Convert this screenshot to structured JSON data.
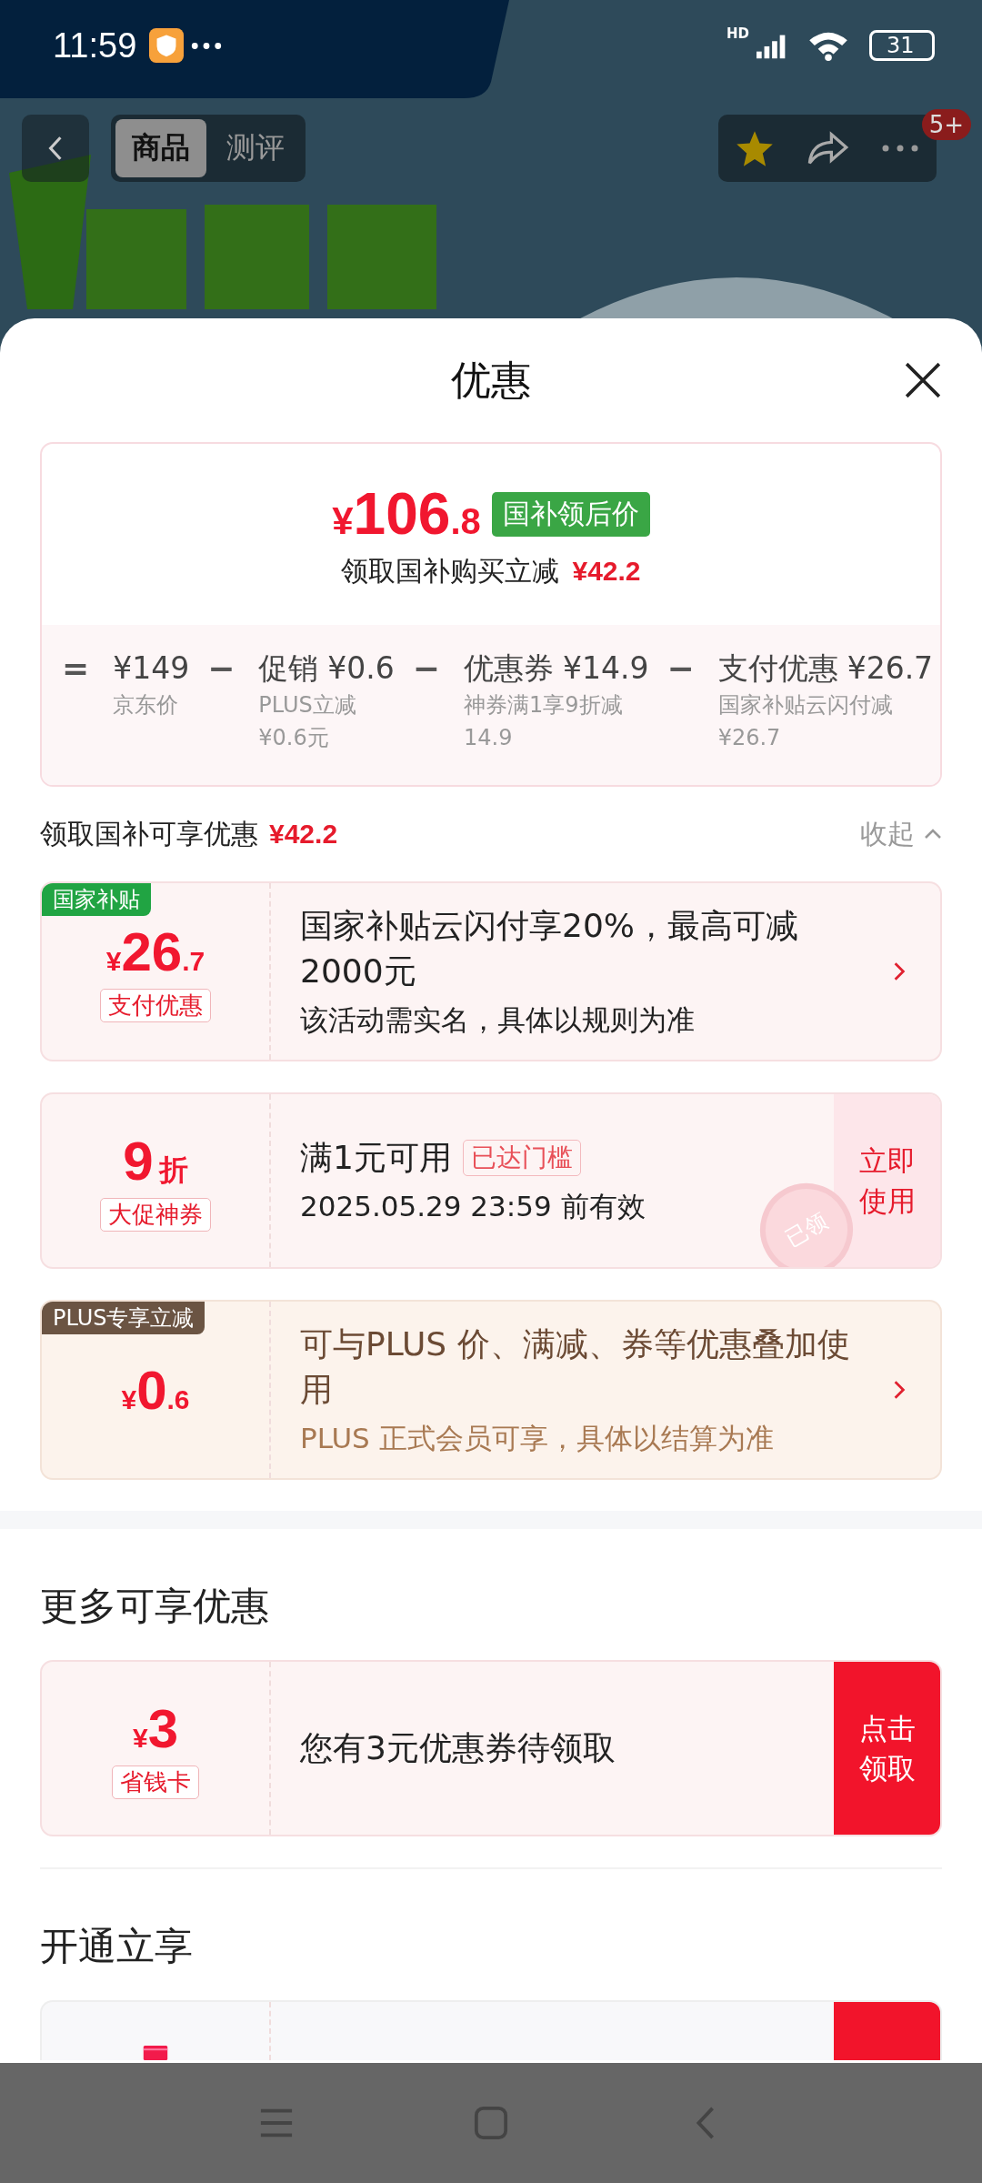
{
  "status_bar": {
    "time": "11:59",
    "network": "HD",
    "battery": "31"
  },
  "header": {
    "tabs": [
      {
        "label": "商品",
        "selected": true
      },
      {
        "label": "测评",
        "selected": false
      }
    ],
    "badge": "5+"
  },
  "sheet": {
    "title": "优惠"
  },
  "price_summary": {
    "currency": "¥",
    "price_int": "106",
    "price_dec": ".8",
    "tag": "国补领后价",
    "subtitle": "领取国补购买立减",
    "subtitle_amount": "¥42.2",
    "breakdown": [
      {
        "op": "=",
        "amount": "¥149",
        "notes": [
          "京东价"
        ]
      },
      {
        "op": "−",
        "label": "促销",
        "amount": "¥0.6",
        "notes": [
          "PLUS立减",
          "¥0.6元"
        ]
      },
      {
        "op": "−",
        "label": "优惠券",
        "amount": "¥14.9",
        "notes": [
          "神券满1享9折减",
          "14.9"
        ]
      },
      {
        "op": "−",
        "label": "支付优惠",
        "amount": "¥26.7",
        "notes": [
          "国家补贴云闪付减",
          "¥26.7"
        ]
      }
    ]
  },
  "section": {
    "title": "领取国补可享优惠",
    "amount": "¥42.2",
    "toggle": "收起"
  },
  "offers": [
    {
      "kind": "subsidy",
      "corner_tag": "国家补贴",
      "currency": "¥",
      "value": "26",
      "decimal": ".7",
      "type_label": "支付优惠",
      "title": "国家补贴云闪付享20%，最高可减2000元",
      "note": "该活动需实名，具体以规则为准"
    },
    {
      "kind": "coupon",
      "value": "9",
      "unit": "折",
      "type_label": "大促神券",
      "title": "满1元可用",
      "status_tag": "已达门槛",
      "note": "2025.05.29 23:59 前有效",
      "action": "立即使用",
      "stamp": "已领"
    },
    {
      "kind": "plus",
      "corner_tag": "PLUS专享立减",
      "currency": "¥",
      "value": "0",
      "decimal": ".6",
      "title": "可与PLUS 价、满减、券等优惠叠加使用",
      "note": "PLUS 正式会员可享，具体以结算为准"
    }
  ],
  "more": {
    "title": "更多可享优惠",
    "offers": [
      {
        "kind": "card",
        "currency": "¥",
        "value": "3",
        "type_label": "省钱卡",
        "title": "您有3元优惠券待领取",
        "action": "点击领取"
      }
    ]
  },
  "open": {
    "title": "开通立享",
    "offers": [
      {
        "kind": "membership"
      }
    ]
  }
}
